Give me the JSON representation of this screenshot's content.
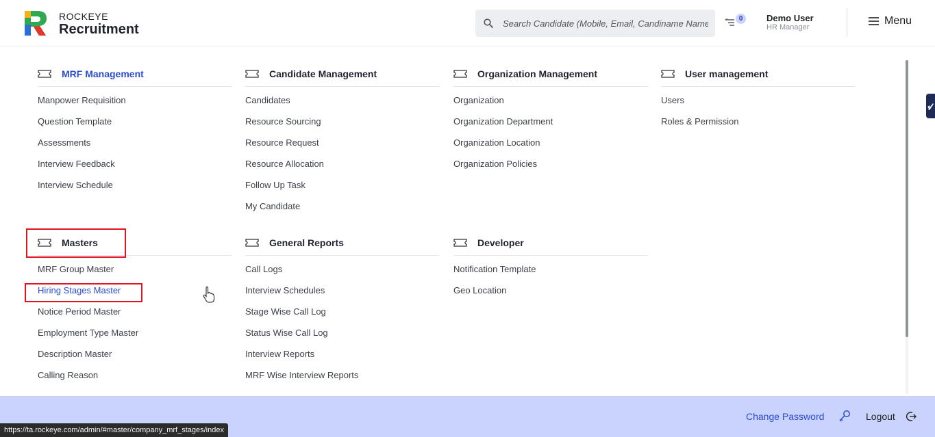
{
  "brand": {
    "top": "ROCKEYE",
    "main": "Recruitment"
  },
  "search": {
    "placeholder": "Search Candidate (Mobile, Email, Candiname Name)"
  },
  "notifications": {
    "count": "0"
  },
  "user": {
    "name": "Demo User",
    "role": "HR Manager"
  },
  "menu": {
    "label": "Menu"
  },
  "sections": [
    {
      "title": "MRF Management",
      "items": [
        "Manpower Requisition",
        "Question Template",
        "Assessments",
        "Interview Feedback",
        "Interview Schedule"
      ]
    },
    {
      "title": "Candidate Management",
      "items": [
        "Candidates",
        "Resource Sourcing",
        "Resource Request",
        "Resource Allocation",
        "Follow Up Task",
        "My Candidate"
      ]
    },
    {
      "title": "Organization Management",
      "items": [
        "Organization",
        "Organization Department",
        "Organization Location",
        "Organization Policies"
      ]
    },
    {
      "title": "User management",
      "items": [
        "Users",
        "Roles & Permission"
      ]
    },
    {
      "title": "Masters",
      "items": [
        "MRF Group Master",
        "Hiring Stages Master",
        "Notice Period Master",
        "Employment Type Master",
        "Description Master",
        "Calling Reason"
      ]
    },
    {
      "title": "General Reports",
      "items": [
        "Call Logs",
        "Interview Schedules",
        "Stage Wise Call Log",
        "Status Wise Call Log",
        "Interview Reports",
        "MRF Wise Interview Reports"
      ]
    },
    {
      "title": "Developer",
      "items": [
        "Notification Template",
        "Geo Location"
      ]
    }
  ],
  "footer": {
    "change_password": "Change Password",
    "logout": "Logout"
  },
  "status_bar": {
    "url": "https://ta.rockeye.com/admin/#master/company_mrf_stages/index"
  },
  "colors": {
    "accent": "#2a4bd6",
    "footer_bg": "#c9d3fb",
    "highlight": "#e0141e"
  }
}
